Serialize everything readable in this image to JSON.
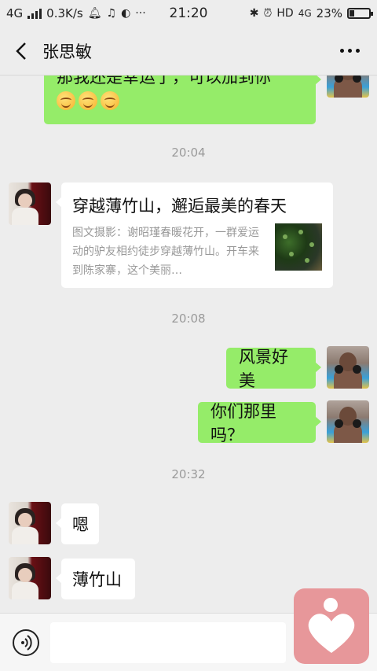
{
  "status_bar": {
    "network": "4G",
    "speed": "0.3K/s",
    "time": "21:20",
    "hd_label": "HD",
    "network_right": "4G",
    "battery_percent": "23%",
    "battery_level": 0.23
  },
  "header": {
    "contact_name": "张思敏"
  },
  "messages": {
    "msg0_text": "那我还是幸运了，可以加到你",
    "time1": "20:04",
    "link": {
      "title": "穿越薄竹山，邂逅最美的春天",
      "description": "图文摄影：谢昭瑾春暖花开，一群爱运动的驴友相约徒步穿越薄竹山。开车来到陈家寨，这个美丽…"
    },
    "time2": "20:08",
    "msg_scenery": "风景好美",
    "msg_there": "你们那里吗？",
    "time3": "20:32",
    "msg_en": "嗯",
    "msg_bozhushan": "薄竹山"
  },
  "colors": {
    "self_bubble": "#95ec69",
    "other_bubble": "#ffffff",
    "background": "#ededed",
    "float_logo": "#e7979a"
  }
}
